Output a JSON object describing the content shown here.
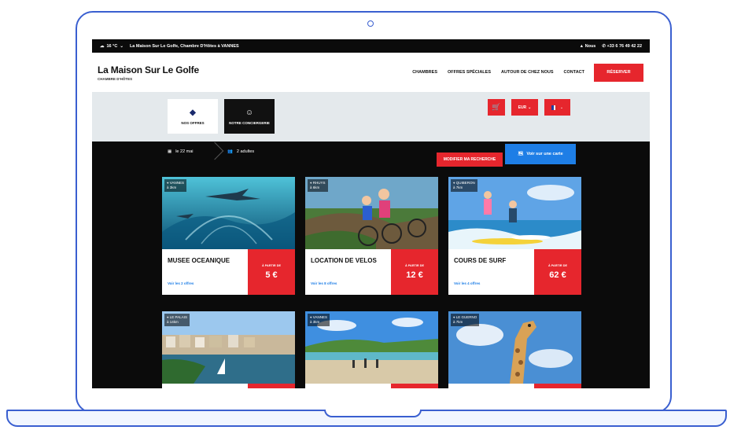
{
  "topbar": {
    "weather": "16 °C",
    "tagline": "La Maison Sur Le Golfe, Chambre D'Hôtes à VANNES",
    "contact_link": "Nous",
    "phone": "+33 6 76 49 42 22"
  },
  "header": {
    "brand_title": "La Maison Sur Le Golfe",
    "brand_subtitle": "CHAMBRE D'HÔTES",
    "nav": [
      "CHAMBRES",
      "OFFRES SPÉCIALES",
      "AUTOUR DE CHEZ NOUS",
      "CONTACT"
    ],
    "reserve_label": "RÉSERVER"
  },
  "tiles": {
    "offers_label": "NOS OFFRES",
    "concierge_label": "NOTRE CONCIERGERIE"
  },
  "currency": "EUR",
  "search": {
    "date": "le 22 mai",
    "people": "2 adultes",
    "modify_label": "MODIFIER MA RECHERCHE",
    "map_label": "Voir sur une carte"
  },
  "cards": [
    {
      "location": "VANNES",
      "distance": "à 3km",
      "title": "MUSEE OCEANIQUE",
      "link": "Voir les 2 offres",
      "from": "À PARTIR DE",
      "price": "5 €"
    },
    {
      "location": "RHUYS",
      "distance": "à 6km",
      "title": "LOCATION DE VELOS",
      "link": "Voir les 8 offres",
      "from": "À PARTIR DE",
      "price": "12 €"
    },
    {
      "location": "QUIBERON",
      "distance": "à 7km",
      "title": "COURS DE SURF",
      "link": "Voir les 4 offres",
      "from": "À PARTIR DE",
      "price": "62 €"
    },
    {
      "location": "LE PALAIS",
      "distance": "à 14km"
    },
    {
      "location": "VANNES",
      "distance": "à 3km"
    },
    {
      "location": "LE GUERNO",
      "distance": "à 7km"
    }
  ],
  "colors": {
    "accent_red": "#e6262d",
    "accent_blue": "#1e7ee6",
    "frame_blue": "#3a5fd0"
  }
}
